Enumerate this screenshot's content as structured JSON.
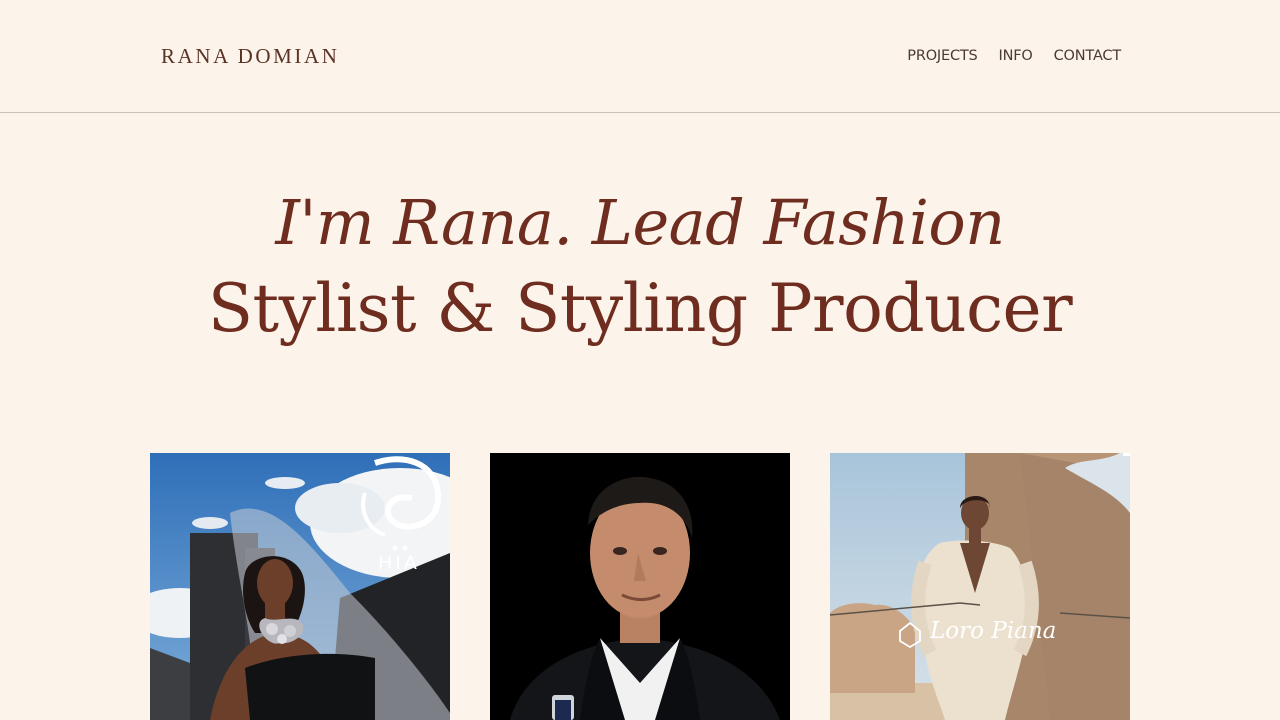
{
  "header": {
    "brand": "RANA DOMIAN",
    "nav": [
      {
        "label": "PROJECTS"
      },
      {
        "label": "INFO"
      },
      {
        "label": "CONTACT"
      }
    ]
  },
  "hero": {
    "line1": "I'm Rana. Lead Fashion",
    "line2": "Stylist & Styling Producer"
  },
  "projects": [
    {
      "logo": "HIA"
    },
    {
      "logo": ""
    },
    {
      "logo": "Loro Piana"
    }
  ],
  "colors": {
    "background": "#fcf3eb",
    "heading": "#6e2d1f",
    "brand": "#5b3226",
    "nav": "#4b3a33"
  }
}
